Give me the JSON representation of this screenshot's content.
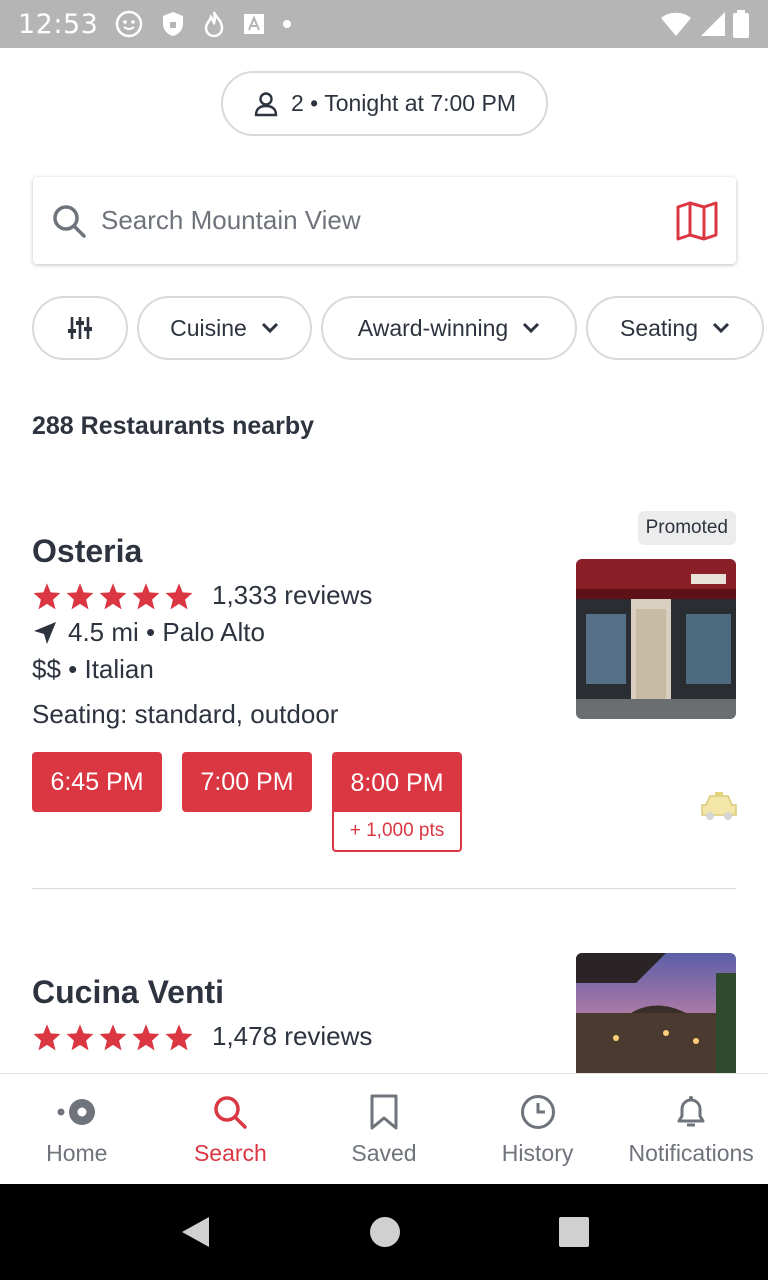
{
  "status": {
    "time": "12:53"
  },
  "party": {
    "label": "2 • Tonight at 7:00 PM"
  },
  "search": {
    "placeholder": "Search  Mountain View"
  },
  "filters": [
    {
      "label": "Cuisine"
    },
    {
      "label": "Award-winning"
    },
    {
      "label": "Seating"
    }
  ],
  "results": {
    "count_label": "288 Restaurants nearby"
  },
  "restaurants": [
    {
      "badge": "Promoted",
      "name": "Osteria",
      "rating": 5,
      "reviews": "1,333 reviews",
      "distance": "4.5 mi • Palo Alto",
      "price_cuisine": "$$ • Italian",
      "seating": "Seating: standard, outdoor",
      "slots": [
        "6:45 PM",
        "7:00 PM",
        "8:00 PM"
      ],
      "bonus": "+ 1,000 pts"
    },
    {
      "name": "Cucina Venti",
      "rating": 5,
      "reviews": "1,478 reviews"
    }
  ],
  "tabs": [
    {
      "label": "Home",
      "icon": "home-icon"
    },
    {
      "label": "Search",
      "icon": "search-icon",
      "active": true
    },
    {
      "label": "Saved",
      "icon": "bookmark-icon"
    },
    {
      "label": "History",
      "icon": "clock-icon"
    },
    {
      "label": "Notifications",
      "icon": "bell-icon"
    }
  ],
  "colors": {
    "accent": "#da3743",
    "text": "#2d333f",
    "muted": "#6f737b",
    "border": "#d8d9db"
  }
}
